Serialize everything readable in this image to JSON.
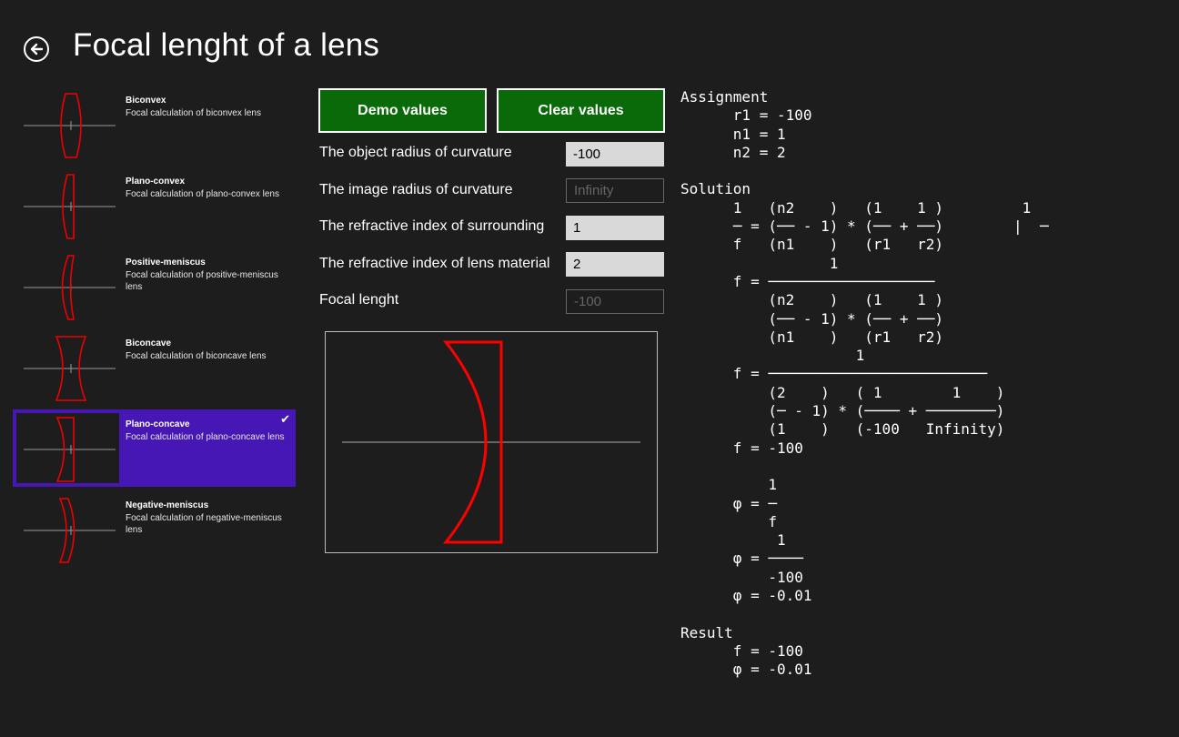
{
  "header": {
    "title": "Focal lenght of a lens",
    "back_icon": "arrow-left-icon"
  },
  "lens_list": [
    {
      "name": "Biconvex",
      "desc": "Focal calculation of biconvex lens",
      "selected": false
    },
    {
      "name": "Plano-convex",
      "desc": "Focal calculation of plano-convex lens",
      "selected": false
    },
    {
      "name": "Positive-meniscus",
      "desc": "Focal calculation of positive-meniscus lens",
      "selected": false
    },
    {
      "name": "Biconcave",
      "desc": "Focal calculation of biconcave lens",
      "selected": false
    },
    {
      "name": "Plano-concave",
      "desc": "Focal calculation of plano-concave lens",
      "selected": true
    },
    {
      "name": "Negative-meniscus",
      "desc": "Focal calculation of negative-meniscus lens",
      "selected": false
    }
  ],
  "buttons": {
    "demo": "Demo values",
    "clear": "Clear values"
  },
  "form": {
    "object_radius": {
      "label": "The object radius of curvature",
      "value": "-100"
    },
    "image_radius": {
      "label": "The image radius of curvature",
      "value": "Infinity"
    },
    "surrounding_index": {
      "label": "The refractive index of surrounding",
      "value": "1"
    },
    "material_index": {
      "label": "The refractive index of lens material",
      "value": "2"
    },
    "focal_length": {
      "label": "Focal lenght",
      "value": "-100"
    }
  },
  "solution_text": "Assignment\n      r1 = -100\n      n1 = 1\n      n2 = 2\n\nSolution\n      1   (n2    )   (1    1 )         1\n      ─ = (── - 1) * (── + ──)        |  ─\n      f   (n1    )   (r1   r2)\n                 1\n      f = ───────────────────\n          (n2    )   (1    1 )\n          (── - 1) * (── + ──)\n          (n1    )   (r1   r2)\n                    1\n      f = ─────────────────────────\n          (2    )   ( 1        1    )\n          (─ - 1) * (──── + ────────)\n          (1    )   (-100   Infinity)\n      f = -100\n\n          1\n      φ = ─\n          f\n           1\n      φ = ────\n          -100\n      φ = -0.01\n\nResult\n      f = -100\n      φ = -0.01",
  "colors": {
    "background": "#1d1d1d",
    "accent_selected": "#4617b4",
    "button_green": "#0a6a0a",
    "lens_red": "#ff0000"
  }
}
